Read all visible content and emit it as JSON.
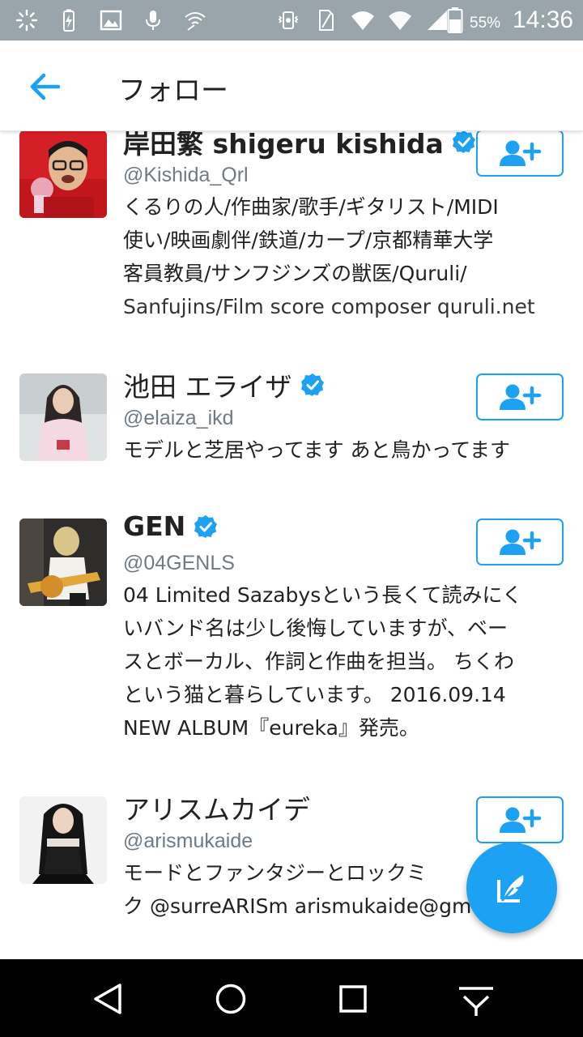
{
  "status_bar": {
    "battery_percent": "55%",
    "time": "14:36",
    "icons": [
      "loading-icon",
      "battery-charging-icon",
      "image-icon",
      "mic-icon",
      "wifi-off-icon",
      "vibrate-icon",
      "sim-icon",
      "wifi-icon",
      "wifi-icon",
      "signal-icon",
      "battery-icon"
    ]
  },
  "header": {
    "title": "フォロー",
    "back_icon": "arrow-left-icon"
  },
  "colors": {
    "accent": "#1da1f2",
    "text": "#222222",
    "secondary": "#6e7b85",
    "status_bar": "#9aa4ab"
  },
  "users": [
    {
      "name": "岸田繁 shigeru kishida",
      "verified": true,
      "handle": "@Kishida_Qrl",
      "bio_lines": [
        "くるりの人/作曲家/歌手/ギタリスト/MIDI",
        "使い/映画劇伴/鉄道/カープ/京都精華大学",
        "客員教員/サンフジンズの獣医/Quruli/",
        "Sanfujins/Film score composer quruli.net"
      ]
    },
    {
      "name": "池田 エライザ",
      "verified": true,
      "handle": "@elaiza_ikd",
      "bio_lines": [
        "モデルと芝居やってます あと鳥かってます"
      ]
    },
    {
      "name": "GEN",
      "verified": true,
      "handle": "@04GENLS",
      "bio_lines": [
        "04 Limited Sazabysという長くて読みにく",
        "いバンド名は少し後悔していますが、ベー",
        "スとボーカル、作詞と作曲を担当。 ちくわ",
        "という猫と暮らしています。 2016.09.14",
        "NEW ALBUM『eureka』発売。"
      ]
    },
    {
      "name": "アリスムカイデ",
      "verified": false,
      "handle": "@arismukaide",
      "bio_lines": [
        "モードとファンタジーとロックミ",
        "ク @surreARISm arismukaide@gma"
      ]
    }
  ],
  "follow_icon": "add-user-icon",
  "fab_icon": "compose-tweet-icon",
  "nav": {
    "back_icon": "nav-back-icon",
    "home_icon": "nav-home-icon",
    "recents_icon": "nav-recents-icon",
    "menu_icon": "nav-hide-icon"
  }
}
